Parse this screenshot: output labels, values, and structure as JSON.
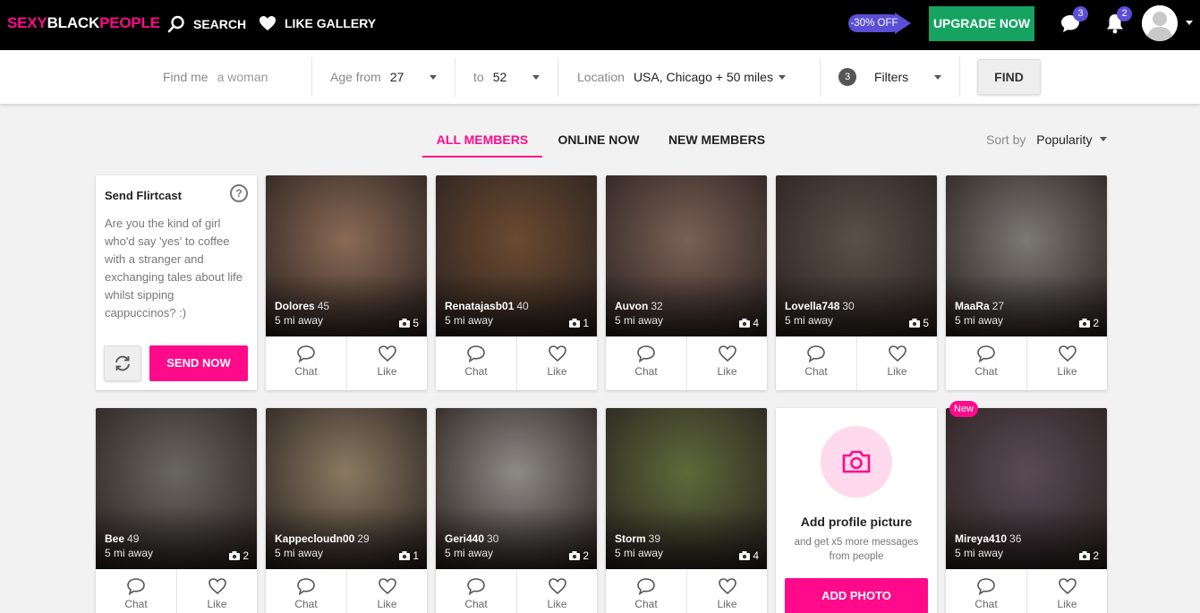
{
  "header": {
    "logo": {
      "part1": "SEXY",
      "part2": "BLACK",
      "part3": "PEOPLE"
    },
    "search_label": "SEARCH",
    "like_gallery_label": "LIKE GALLERY",
    "discount_label": "-30% OFF",
    "upgrade_label": "UPGRADE NOW",
    "messages_count": "3",
    "notifications_count": "2",
    "brand_color": "#ff0a8a",
    "accent_color": "#5b4fd6",
    "upgrade_color": "#16a362"
  },
  "filters": {
    "find_me_label": "Find me",
    "find_me_value": "a woman",
    "age_from_label": "Age from",
    "age_from_value": "27",
    "age_to_label": "to",
    "age_to_value": "52",
    "location_label": "Location",
    "location_value": "USA, Chicago + 50 miles",
    "filters_count": "3",
    "filters_label": "Filters",
    "find_button": "FIND"
  },
  "tabs": {
    "all": "ALL MEMBERS",
    "online": "ONLINE NOW",
    "new": "NEW MEMBERS",
    "active": "all"
  },
  "sort": {
    "label": "Sort by",
    "value": "Popularity"
  },
  "flirtcast": {
    "title": "Send Flirtcast",
    "help": "?",
    "text": "Are you the kind of girl who'd say 'yes' to coffee with a stranger and exchanging tales about life whilst sipping cappuccinos? :)",
    "send_button": "SEND NOW"
  },
  "action_labels": {
    "chat": "Chat",
    "like": "Like"
  },
  "members": [
    {
      "name": "Dolores",
      "age": "45",
      "distance": "5 mi away",
      "photos": "5",
      "color": "#8a6a55"
    },
    {
      "name": "Renatajasb01",
      "age": "40",
      "distance": "5 mi away",
      "photos": "1",
      "color": "#6b4a30"
    },
    {
      "name": "Auvon",
      "age": "32",
      "distance": "5 mi away",
      "photos": "4",
      "color": "#7a6055"
    },
    {
      "name": "Lovella748",
      "age": "30",
      "distance": "5 mi away",
      "photos": "5",
      "color": "#5a5048"
    },
    {
      "name": "MaaRa",
      "age": "27",
      "distance": "5 mi away",
      "photos": "2",
      "color": "#7c7874"
    },
    {
      "name": "Bee",
      "age": "49",
      "distance": "5 mi away",
      "photos": "2",
      "color": "#6a6660"
    },
    {
      "name": "Kappecloudn00",
      "age": "29",
      "distance": "5 mi away",
      "photos": "1",
      "color": "#8a7a62"
    },
    {
      "name": "Geri440",
      "age": "30",
      "distance": "5 mi away",
      "photos": "2",
      "color": "#8e8a86"
    },
    {
      "name": "Storm",
      "age": "39",
      "distance": "5 mi away",
      "photos": "4",
      "color": "#5e6a3a"
    },
    {
      "name": "Mireya410",
      "age": "36",
      "distance": "5 mi away",
      "photos": "2",
      "color": "#5a4a55",
      "is_new": true
    }
  ],
  "new_badge": "New",
  "add_photo": {
    "title": "Add profile picture",
    "subtitle": "and get x5 more messages from people",
    "button": "ADD PHOTO"
  }
}
